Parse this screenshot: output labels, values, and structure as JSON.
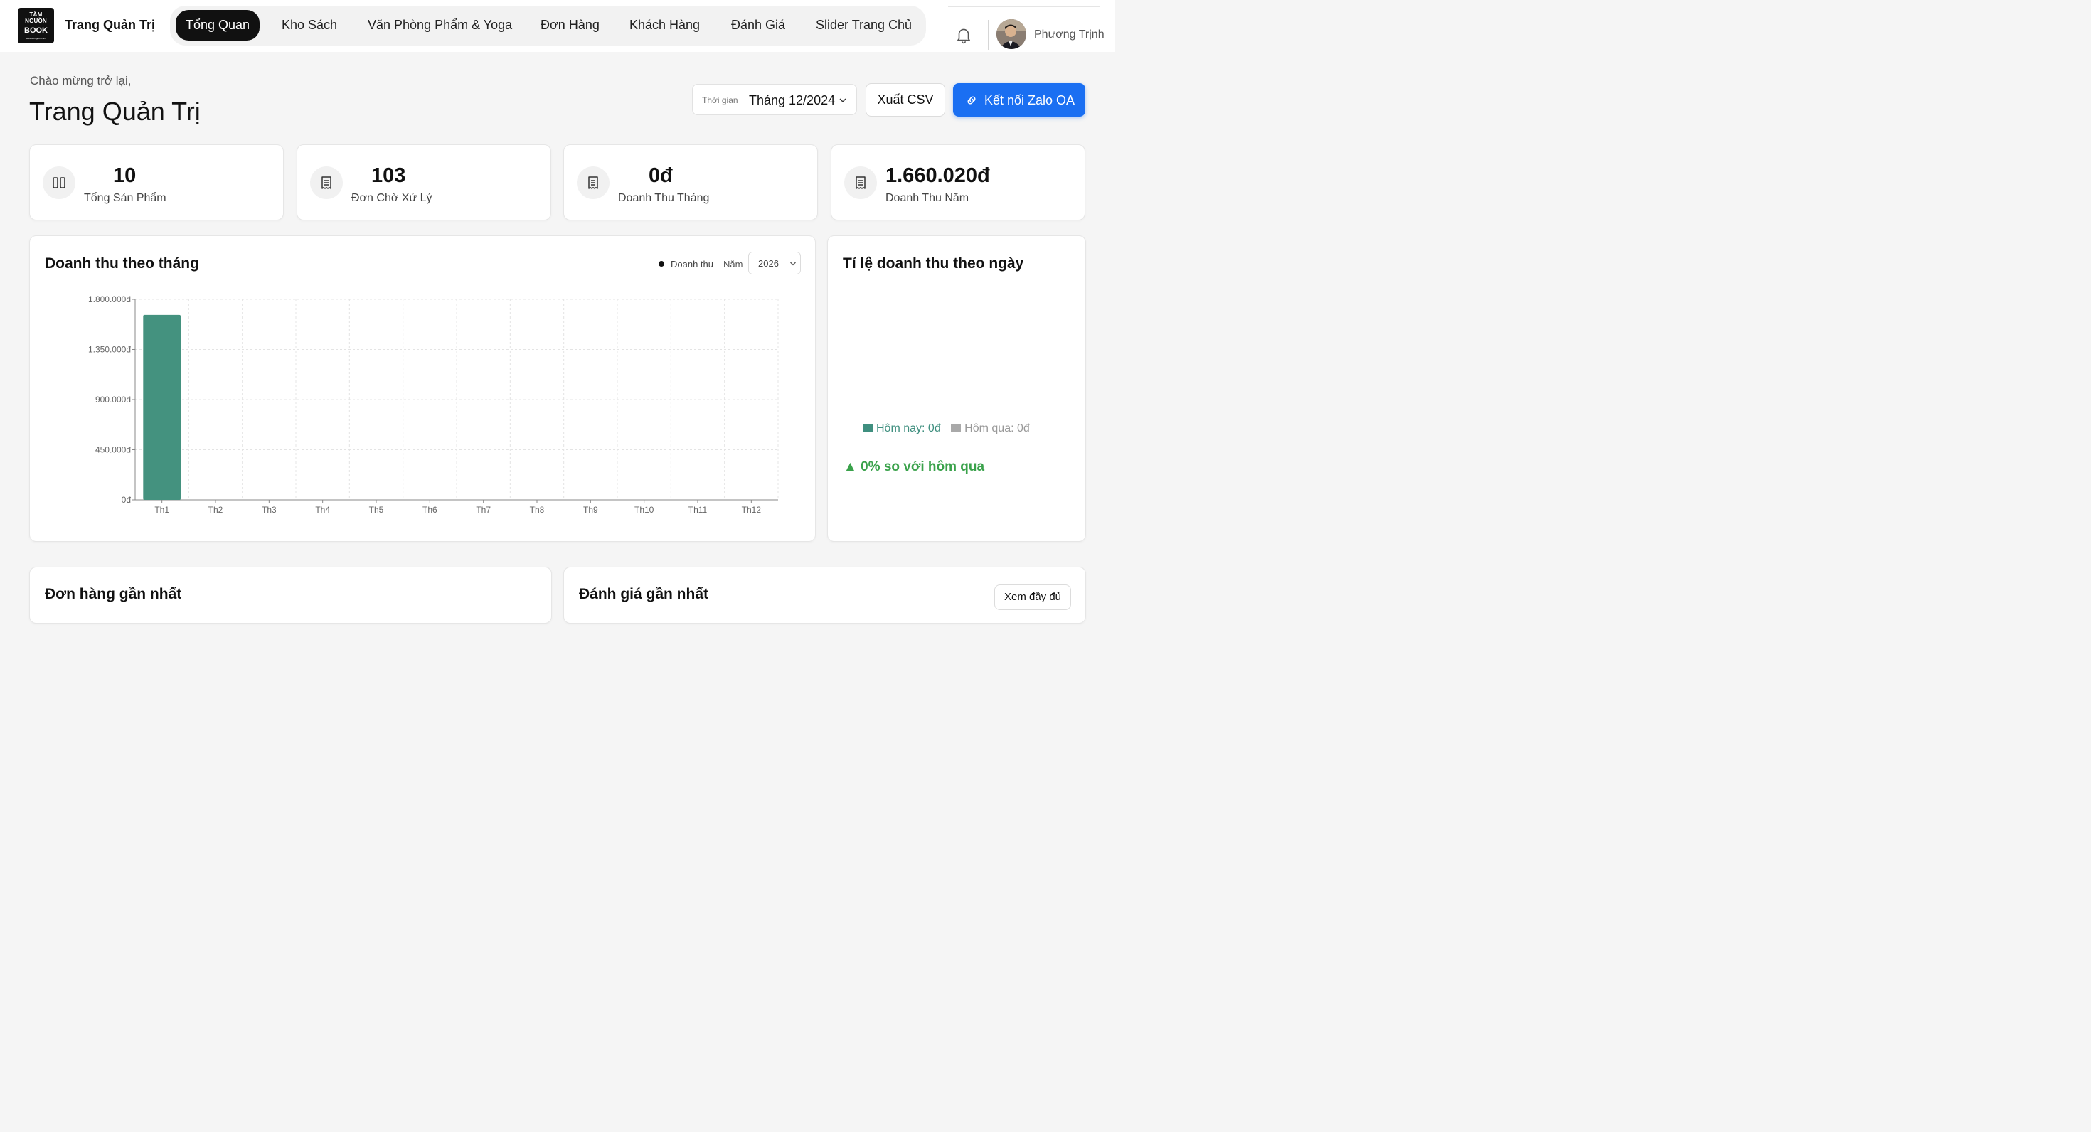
{
  "brand": {
    "logo_line1": "TÂM",
    "logo_line2": "NGUỒN",
    "logo_line3": "BOOK",
    "logo_line4": "www.tamnguon.com",
    "title": "Trang Quản Trị"
  },
  "nav": {
    "items": [
      {
        "label": "Tổng Quan",
        "active": true
      },
      {
        "label": "Kho Sách",
        "active": false
      },
      {
        "label": "Văn Phòng Phẩm & Yoga",
        "active": false
      },
      {
        "label": "Đơn Hàng",
        "active": false
      },
      {
        "label": "Khách Hàng",
        "active": false
      },
      {
        "label": "Đánh Giá",
        "active": false
      },
      {
        "label": "Slider Trang Chủ",
        "active": false
      }
    ]
  },
  "user": {
    "name": "Phương Trịnh",
    "notification_icon": "bell-icon"
  },
  "header": {
    "welcome": "Chào mừng trở lại,",
    "title": "Trang Quản Trị",
    "period_label": "Thời gian",
    "period_value": "Tháng 12/2024",
    "export_label": "Xuất CSV",
    "zalo_label": "Kết nối Zalo OA"
  },
  "stats": [
    {
      "value": "10",
      "label": "Tổng Sản Phẩm",
      "icon": "columns-icon"
    },
    {
      "value": "103",
      "label": "Đơn Chờ Xử Lý",
      "icon": "receipt-icon"
    },
    {
      "value": "0đ",
      "label": "Doanh Thu Tháng",
      "icon": "receipt-icon"
    },
    {
      "value": "1.660.020đ",
      "label": "Doanh Thu Năm",
      "icon": "receipt-icon"
    }
  ],
  "revenue": {
    "title": "Doanh thu theo tháng",
    "legend_label": "Doanh thu",
    "year_label": "Năm",
    "year_value": "2026"
  },
  "chart_data": {
    "type": "bar",
    "title": "Doanh thu theo tháng",
    "categories": [
      "Th1",
      "Th2",
      "Th3",
      "Th4",
      "Th5",
      "Th6",
      "Th7",
      "Th8",
      "Th9",
      "Th10",
      "Th11",
      "Th12"
    ],
    "series": [
      {
        "name": "Doanh thu",
        "values": [
          1660020,
          0,
          0,
          0,
          0,
          0,
          0,
          0,
          0,
          0,
          0,
          0
        ],
        "color": "#44927f"
      }
    ],
    "yticks": [
      0,
      450000,
      900000,
      1350000,
      1800000
    ],
    "ytick_labels": [
      "0đ",
      "450.000đ",
      "900.000đ",
      "1.350.000đ",
      "1.800.000đ"
    ],
    "ylim": [
      0,
      1800000
    ],
    "grid": true,
    "legend": "top-right"
  },
  "ratio": {
    "title": "Tỉ lệ doanh thu theo ngày",
    "today_label": "Hôm nay: 0đ",
    "yesterday_label": "Hôm qua: 0đ",
    "change_text": "▲ 0% so với hôm qua",
    "today_color": "#3f8f7f",
    "yesterday_color": "#a9a9a9"
  },
  "recent_orders": {
    "title": "Đơn hàng gần nhất"
  },
  "recent_reviews": {
    "title": "Đánh giá gần nhất",
    "view_all_label": "Xem đầy đủ"
  }
}
